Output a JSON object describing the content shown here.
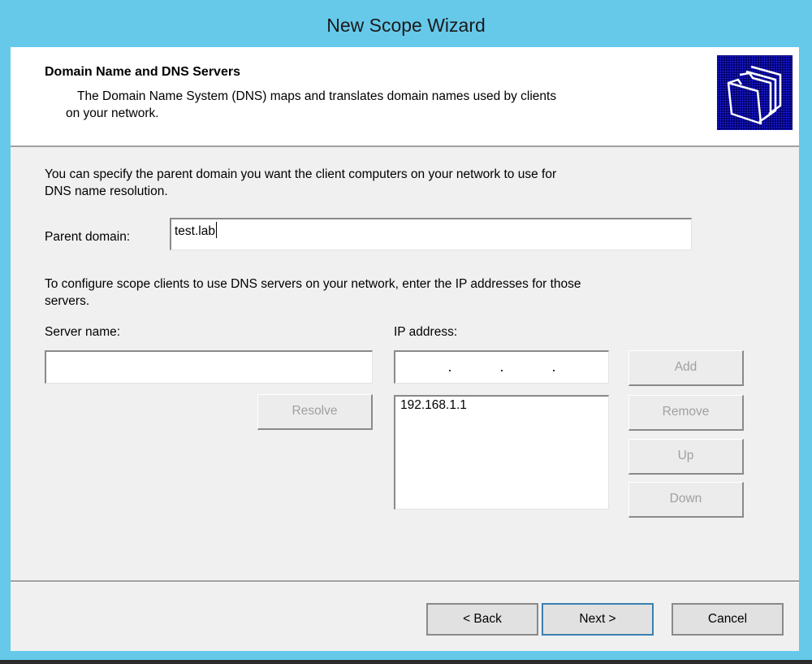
{
  "window": {
    "title": "New Scope Wizard"
  },
  "header": {
    "title": "Domain Name and DNS Servers",
    "subtitle_line1": "The Domain Name System (DNS) maps and translates domain names used by clients",
    "subtitle_line2": "on your network.",
    "icon": "folders-icon"
  },
  "parent_domain": {
    "instructions_line1": "You can specify the parent domain you want the client computers on your network to use for",
    "instructions_line2": "DNS name resolution.",
    "label": "Parent domain:",
    "value": "test.lab"
  },
  "dns_servers": {
    "instructions_line1": "To configure scope clients to use DNS servers on your network, enter the IP addresses for those",
    "instructions_line2": "servers.",
    "server_name_label": "Server name:",
    "server_name_value": "",
    "ip_address_label": "IP address:",
    "ip_address_value": "",
    "ip_list": [
      "192.168.1.1"
    ],
    "buttons": {
      "resolve": "Resolve",
      "add": "Add",
      "remove": "Remove",
      "up": "Up",
      "down": "Down"
    }
  },
  "footer": {
    "back": "< Back",
    "next": "Next >",
    "cancel": "Cancel"
  }
}
